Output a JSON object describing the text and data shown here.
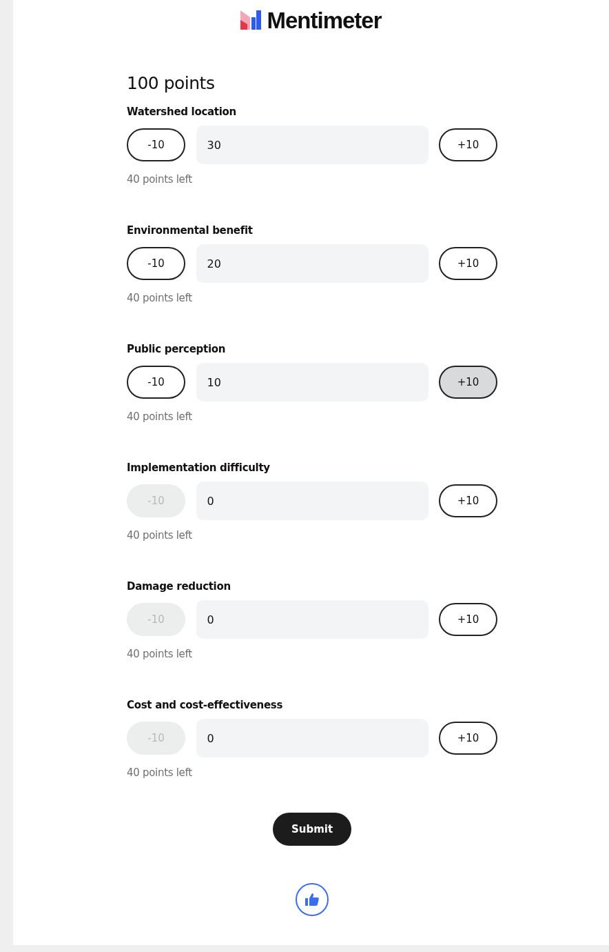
{
  "logo": {
    "text": "Mentimeter"
  },
  "title": "100 points",
  "items": [
    {
      "label": "Watershed location",
      "minus": "-10",
      "value": "30",
      "plus": "+10",
      "minus_disabled": false,
      "plus_hovered": false,
      "remaining": "40 points left"
    },
    {
      "label": "Environmental benefit",
      "minus": "-10",
      "value": "20",
      "plus": "+10",
      "minus_disabled": false,
      "plus_hovered": false,
      "remaining": "40 points left"
    },
    {
      "label": "Public perception",
      "minus": "-10",
      "value": "10",
      "plus": "+10",
      "minus_disabled": false,
      "plus_hovered": true,
      "remaining": "40 points left"
    },
    {
      "label": "Implementation difficulty",
      "minus": "-10",
      "value": "0",
      "plus": "+10",
      "minus_disabled": true,
      "plus_hovered": false,
      "remaining": "40 points left"
    },
    {
      "label": "Damage reduction",
      "minus": "-10",
      "value": "0",
      "plus": "+10",
      "minus_disabled": true,
      "plus_hovered": false,
      "remaining": "40 points left"
    },
    {
      "label": "Cost and cost-effectiveness",
      "minus": "-10",
      "value": "0",
      "plus": "+10",
      "minus_disabled": true,
      "plus_hovered": false,
      "remaining": "40 points left"
    }
  ],
  "submit": "Submit"
}
